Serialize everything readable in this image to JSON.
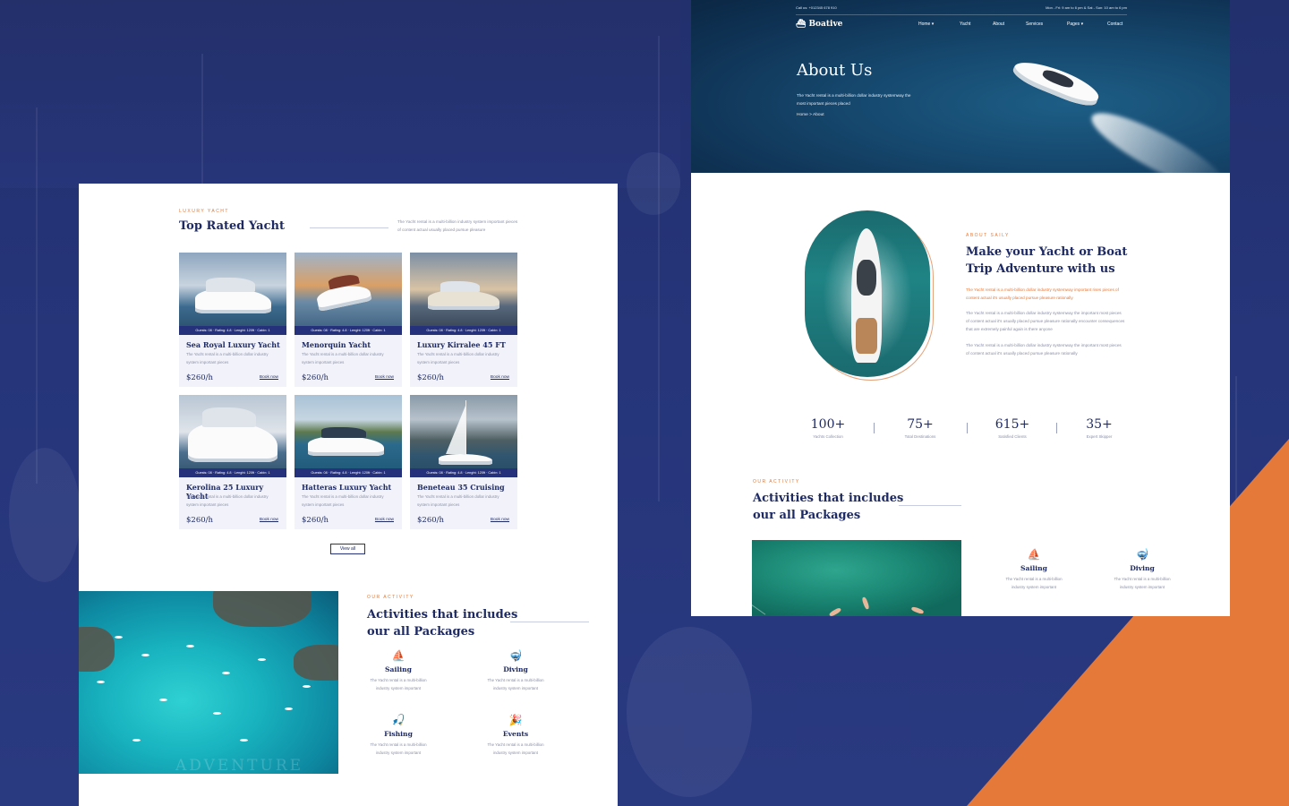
{
  "colors": {
    "navy": "#25317a",
    "title_navy": "#1e2a63",
    "accent_orange": "#e4793a",
    "background": "#243070",
    "card_bg": "#f2f3fa"
  },
  "left": {
    "top_rated": {
      "eyebrow": "LUXURY YACHT",
      "title": "Top Rated Yacht",
      "description": "The Yacht rental is a multi-billion industry system important pieces of content actual usually placed pursue pleasure"
    },
    "cards": [
      {
        "meta": "Guests: 08 · Rating: 4.8 · Lenght: 120ft · Cabin: 1",
        "title": "Sea Royal Luxury Yacht",
        "desc": "The Yacht rental is a multi-billion dollar industry system important pieces",
        "price": "$260/h",
        "book": "Book now"
      },
      {
        "meta": "Guests: 08 · Rating: 4.8 · Lenght: 120ft · Cabin: 1",
        "title": "Menorquin Yacht",
        "desc": "The Yacht rental is a multi-billion dollar industry system important pieces",
        "price": "$260/h",
        "book": "Book now"
      },
      {
        "meta": "Guests: 08 · Rating: 4.8 · Lenght: 120ft · Cabin: 1",
        "title": "Luxury Kirralee 45 FT",
        "desc": "The Yacht rental is a multi-billion dollar industry system important pieces",
        "price": "$260/h",
        "book": "Book now"
      },
      {
        "meta": "Guests: 08 · Rating: 4.8 · Lenght: 120ft · Cabin: 1",
        "title": "Kerolina 25 Luxury Yacht",
        "desc": "The Yacht rental is a multi-billion dollar industry system important pieces",
        "price": "$260/h",
        "book": "Book now"
      },
      {
        "meta": "Guests: 08 · Rating: 4.8 · Lenght: 120ft · Cabin: 1",
        "title": "Hatteras Luxury Yacht",
        "desc": "The Yacht rental is a multi-billion dollar industry system important pieces",
        "price": "$260/h",
        "book": "Book now"
      },
      {
        "meta": "Guests: 08 · Rating: 4.8 · Lenght: 120ft · Cabin: 1",
        "title": "Beneteau 35 Cruising",
        "desc": "The Yacht rental is a multi-billion dollar industry system important pieces",
        "price": "$260/h",
        "book": "Book now"
      }
    ],
    "view_all": "View all",
    "lagoon_watermark": "ADVENTURE",
    "activity": {
      "eyebrow": "OUR ACTIVITY",
      "title_line1": "Activities that includes",
      "title_line2": "our all Packages",
      "items": [
        {
          "icon": "sailboat-icon",
          "glyph": "⛵",
          "label": "Sailing",
          "desc1": "The Yacht rental is a multi-billion",
          "desc2": "industry system important"
        },
        {
          "icon": "diving-icon",
          "glyph": "🤿",
          "label": "Diving",
          "desc1": "The Yacht rental is a multi-billion",
          "desc2": "industry system important"
        },
        {
          "icon": "fishing-icon",
          "glyph": "🎣",
          "label": "Fishing",
          "desc1": "The Yacht rental is a multi-billion",
          "desc2": "industry system important"
        },
        {
          "icon": "events-icon",
          "glyph": "🎉",
          "label": "Events",
          "desc1": "The Yacht rental is a multi-billion",
          "desc2": "industry system important"
        }
      ]
    }
  },
  "right": {
    "topbar": {
      "call": "Call us: +012345 678 910",
      "hours": "Mon - Fri: 9 am to 6 pm & Sat - Sun: 10 am to 6 pm"
    },
    "logo": "Boative",
    "nav": [
      "Home",
      "Yacht",
      "About",
      "Services",
      "Pages",
      "Contact"
    ],
    "hero": {
      "title": "About Us",
      "subtitle": "The Yacht rental is a multi-billion dollar industry systemway the most important pieces placed",
      "breadcrumb_home": "Home",
      "breadcrumb_sep": ">",
      "breadcrumb_current": "About"
    },
    "about": {
      "eyebrow": "ABOUT SAILY",
      "title": "Make your Yacht or Boat Trip Adventure with us",
      "orange_text": "The Yacht rental is a multi-billion dollar industry systemway important rises pieces of content actual it's usually placed pursue pleasure rationally",
      "para1": "The Yacht rental is a multi-billion dollar industry systemway the important most pieces of content actual it's usually placed pursue pleasure rationally encounter consequences that are extremely painful again is there anyone",
      "para2": "The Yacht rental is a multi-billion dollar industry systemway the important most pieces of content actual it's usually placed pursue pleasure rationally"
    },
    "stats": [
      {
        "num": "100+",
        "label": "Yachts Collection"
      },
      {
        "num": "75+",
        "label": "Total Destinations"
      },
      {
        "num": "615+",
        "label": "Satisfied Clients"
      },
      {
        "num": "35+",
        "label": "Expert Skipper"
      }
    ],
    "activity": {
      "eyebrow": "OUR ACTIVITY",
      "title_line1": "Activities that includes",
      "title_line2": "our all Packages",
      "items": [
        {
          "icon": "sailboat-icon",
          "glyph": "⛵",
          "label": "Sailing",
          "desc1": "The Yacht rental is a multi-billion",
          "desc2": "industry system important"
        },
        {
          "icon": "diving-icon",
          "glyph": "🤿",
          "label": "Diving",
          "desc1": "The Yacht rental is a multi-billion",
          "desc2": "industry system important"
        }
      ]
    }
  }
}
